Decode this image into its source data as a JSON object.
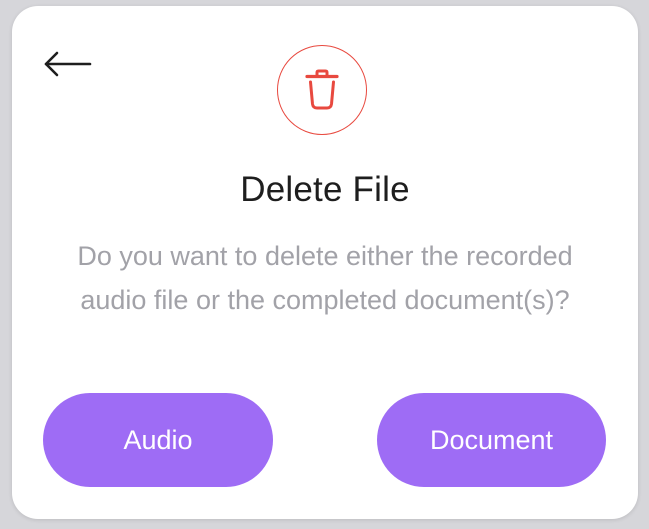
{
  "dialog": {
    "title": "Delete File",
    "message": "Do you want to delete either the recorded audio file or the completed document(s)?",
    "audio_button_label": "Audio",
    "document_button_label": "Document"
  },
  "icons": {
    "back": "arrow-left-icon",
    "delete": "trash-icon"
  },
  "colors": {
    "accent_button": "#9e6cf5",
    "danger": "#e8493f",
    "message_text": "#a2a2a8",
    "title_text": "#1e1e1e"
  }
}
